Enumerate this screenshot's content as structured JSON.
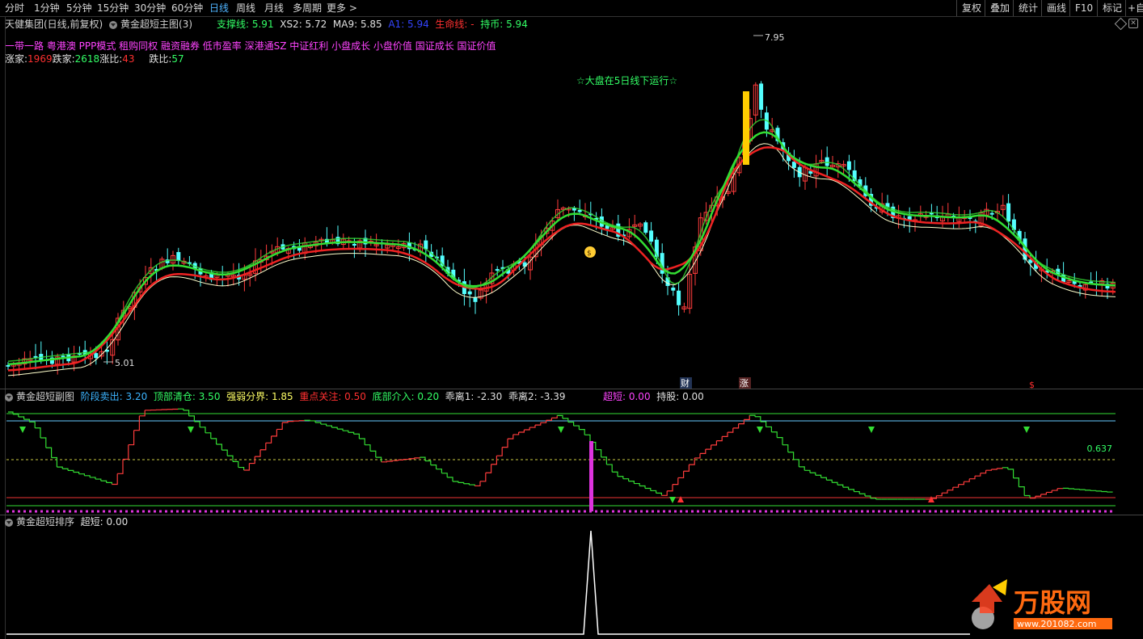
{
  "toolbar": {
    "periods": [
      "分时",
      "1分钟",
      "5分钟",
      "15分钟",
      "30分钟",
      "60分钟",
      "日线",
      "周线",
      "月线",
      "多周期",
      "更多 >"
    ],
    "active_period": "日线",
    "right_buttons": [
      "复权",
      "叠加",
      "统计",
      "画线",
      "F10",
      "标记",
      "+自"
    ]
  },
  "main_panel": {
    "stock_title": "天健集团(日线,前复权)",
    "indicator_name": "黄金超短主图(3)",
    "values": [
      {
        "label": "支撑线: 5.91",
        "color": "#33ff66"
      },
      {
        "label": "XS2: 5.72",
        "color": "#e0e0e0"
      },
      {
        "label": "MA9: 5.85",
        "color": "#e0e0e0"
      },
      {
        "label": "A1: 5.94",
        "color": "#3344ff"
      },
      {
        "label": "生命线: -",
        "color": "#ff3030"
      },
      {
        "label": "持币: 5.94",
        "color": "#33ff66"
      }
    ],
    "concepts": "一带一路 粤港澳 PPP模式 租购同权 融资融券 低市盈率 深港通SZ 中证红利 小盘成长 小盘价值 国证成长 国证价值",
    "breadth": {
      "zhangjia_label": "涨家:",
      "zhangjia_value": "1969",
      "diejia_label": "跌家:",
      "diejia_value": "2618",
      "zhangbi_label": "涨比:",
      "zhangbi_value": "43",
      "diebi_label": "跌比:",
      "diebi_value": "57"
    },
    "market_note": "☆大盘在5日线下运行☆",
    "high_label": "7.95",
    "low_label": "5.01",
    "marker_cai": "财",
    "marker_zhang": "涨",
    "marker_dollar": "$"
  },
  "sub_panel": {
    "title": "黄金超短副图",
    "values": [
      {
        "label": "阶段卖出: 3.20",
        "color": "#3cb4ff"
      },
      {
        "label": "顶部清仓: 3.50",
        "color": "#33ff66"
      },
      {
        "label": "强弱分界: 1.85",
        "color": "#ffff66"
      },
      {
        "label": "重点关注: 0.50",
        "color": "#ff3030"
      },
      {
        "label": "底部介入: 0.20",
        "color": "#33ff66"
      },
      {
        "label": "乖离1: -2.30",
        "color": "#e0e0e0"
      },
      {
        "label": "乖离2: -3.39",
        "color": "#e0e0e0"
      }
    ],
    "extra": [
      {
        "label": "超短: 0.00",
        "color": "#ff44ff"
      },
      {
        "label": "持股: 0.00",
        "color": "#e0e0e0"
      }
    ],
    "level_label": "0.637"
  },
  "bottom_panel": {
    "title": "黄金超短排序",
    "value_label": "超短: 0.00"
  },
  "watermark": {
    "brand": "万股网",
    "url": "www.201082.com"
  },
  "colors": {
    "up": "#ff3c3c",
    "down": "#54ffff",
    "ma_green": "#33dd33",
    "ma_red": "#ee2222",
    "ma_white": "#ffffcc",
    "signal_yellow": "#ffcc00",
    "signal_magenta": "#dd33dd"
  }
}
